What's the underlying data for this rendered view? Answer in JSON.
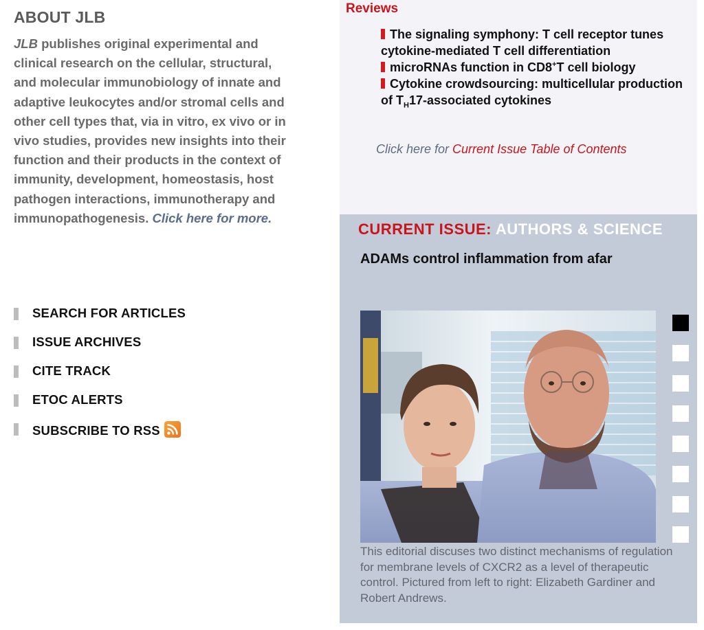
{
  "about": {
    "title": "ABOUT JLB",
    "journal_abbr": "JLB",
    "description": " publishes original experimental and clinical research on the cellular, structural, and molecular immunobiology of innate and adaptive leukocytes and/or stromal cells and other cell types that, via in vitro, ex vivo or in vivo studies, provides new insights into their function and their products in the context of immunity, development, homeostasis, host pathogen interactions, immunotherapy and immunopathogenesis. ",
    "more_link": "Click here for more."
  },
  "nav": {
    "items": [
      {
        "label": "SEARCH FOR ARTICLES"
      },
      {
        "label": "ISSUE ARCHIVES"
      },
      {
        "label": "CITE TRACK"
      },
      {
        "label": "ETOC ALERTS"
      },
      {
        "label": "SUBSCRIBE TO RSS",
        "icon": "rss-icon"
      }
    ]
  },
  "reviews": {
    "title": "Reviews",
    "items": [
      {
        "text": "The signaling symphony: T cell receptor tunes cytokine-mediated T cell differentiation"
      },
      {
        "pre": "microRNAs function in CD8",
        "sup": "+",
        "post": "T cell biology"
      },
      {
        "pre": "Cytokine crowdsourcing: multicellular production of T",
        "sub": "H",
        "post": "17-associated cytokines"
      }
    ],
    "toc_prefix": "Click here for ",
    "toc_link": "Current Issue Table of Contents"
  },
  "current_issue": {
    "header_red": "CURRENT ISSUE:",
    "header_white": "AUTHORS & SCIENCE",
    "headline": "ADAMs control inflammation from afar",
    "caption": "This editorial discuses two distinct mechanisms of regulation for membrane levels of CXCR2 as a level of therapeutic control. Pictured from left to right: Elizabeth Gardiner and Robert Andrews.",
    "slides": {
      "count": 8,
      "active_index": 0
    }
  },
  "colors": {
    "accent_red": "#c8151b",
    "reviews_bg": "#f4f3f7",
    "issue_bg": "#c4cbd8",
    "nav_bar": "#bdbdbd"
  }
}
